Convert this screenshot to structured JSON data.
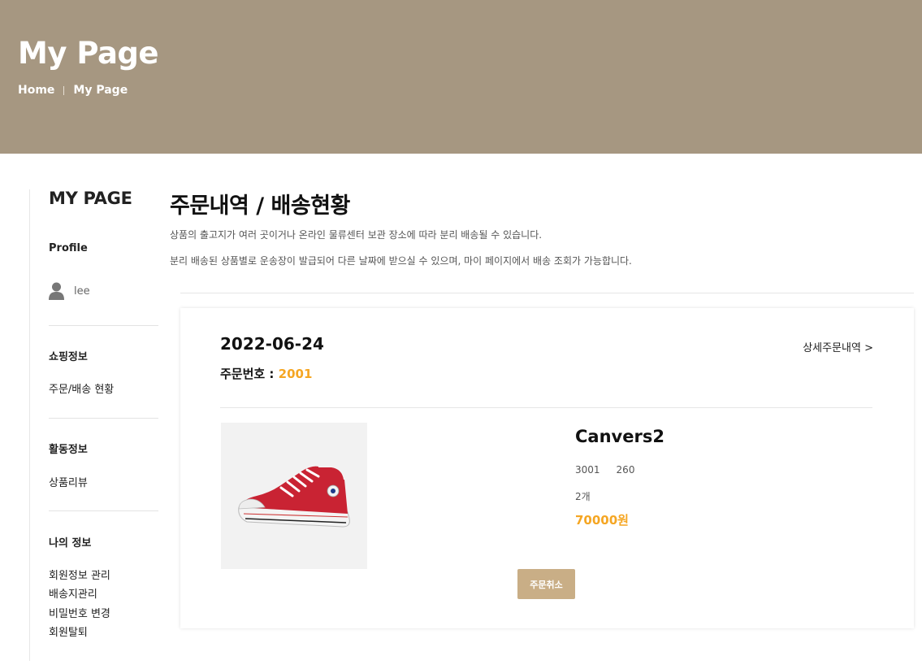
{
  "header": {
    "title": "My Page",
    "breadcrumb": [
      "Home",
      "My Page"
    ]
  },
  "sidebar": {
    "title": "MY PAGE",
    "profile_label": "Profile",
    "username": "lee",
    "sections": [
      {
        "heading": "쇼핑정보",
        "links": [
          "주문/배송 현황"
        ]
      },
      {
        "heading": "활동정보",
        "links": [
          "상품리뷰"
        ]
      },
      {
        "heading": "나의 정보",
        "links": [
          "회원정보 관리",
          "배송지관리",
          "비밀번호 변경",
          "회원탈퇴"
        ]
      }
    ]
  },
  "main": {
    "title": "주문내역 / 배송현황",
    "descriptions": [
      "상품의 출고지가 여러 곳이거나 온라인 물류센터 보관 장소에 따라 분리 배송될 수 있습니다.",
      "분리 배송된 상품별로 운송장이 발급되어 다른 날짜에 받으실 수 있으며, 마이 페이지에서 배송 조회가 가능합니다."
    ]
  },
  "order": {
    "date": "2022-06-24",
    "number_label": "주문번호 : ",
    "number": "2001",
    "detail_link": "상세주문내역 >",
    "product": {
      "name": "Canvers2",
      "code": "3001",
      "size": "260",
      "quantity": "2개",
      "price": "70000원"
    },
    "cancel_label": "주문취소"
  },
  "colors": {
    "header_bg": "#a69781",
    "accent": "#f5a623",
    "button_bg": "#c9ae86"
  }
}
